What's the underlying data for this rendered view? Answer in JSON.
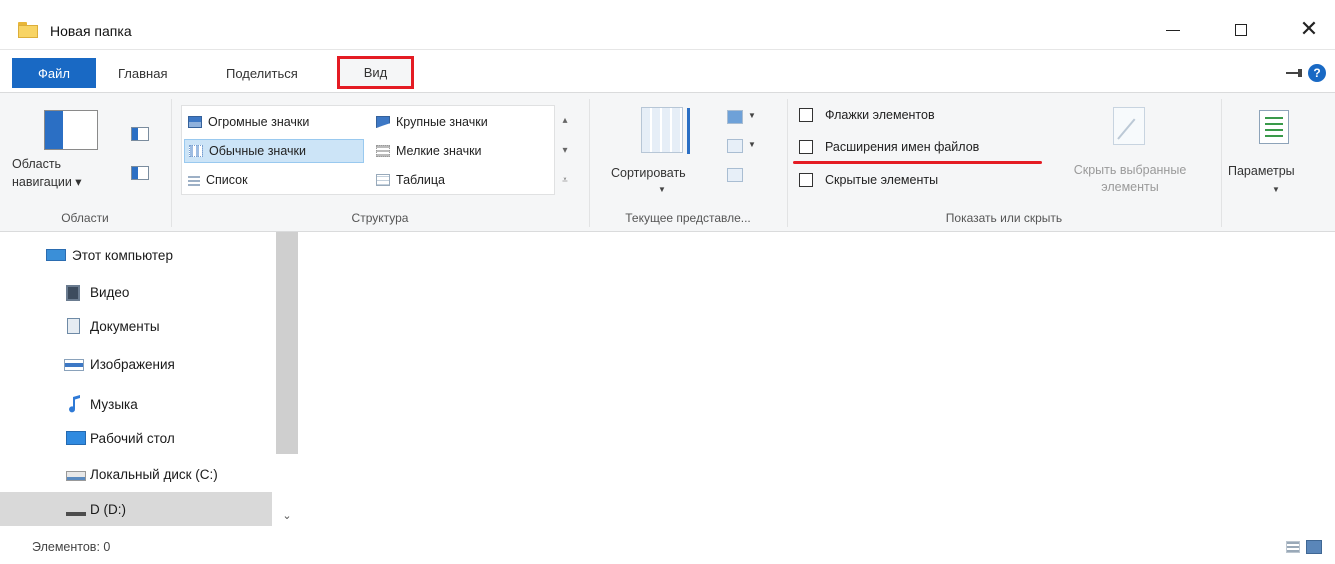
{
  "window": {
    "title": "Новая папка"
  },
  "ribbon_tabs": {
    "file": "Файл",
    "home": "Главная",
    "share": "Поделиться",
    "view": "Вид"
  },
  "groups": {
    "areas": {
      "label": "Области",
      "nav_pane_line1": "Область",
      "nav_pane_line2": "навигации ▾"
    },
    "structure": {
      "label": "Структура",
      "layouts": [
        "Огромные значки",
        "Крупные значки",
        "Обычные значки",
        "Мелкие значки",
        "Список",
        "Таблица"
      ],
      "selected_layout": "Обычные значки"
    },
    "current_view": {
      "label": "Текущее представле...",
      "sort_label": "Сортировать"
    },
    "show_hide": {
      "label": "Показать или скрыть",
      "item_checkboxes": "Флажки элементов",
      "file_extensions": "Расширения имен файлов",
      "hidden_items": "Скрытые элементы",
      "hide_selected_line1": "Скрыть выбранные",
      "hide_selected_line2": "элементы",
      "checked": {
        "item_checkboxes": false,
        "file_extensions": false,
        "hidden_items": false
      }
    },
    "options": {
      "label": "Параметры"
    }
  },
  "navigation": {
    "items": [
      {
        "label": "Этот компьютер",
        "icon": "computer-icon"
      },
      {
        "label": "Видео",
        "icon": "video-icon"
      },
      {
        "label": "Документы",
        "icon": "documents-icon"
      },
      {
        "label": "Изображения",
        "icon": "images-icon"
      },
      {
        "label": "Музыка",
        "icon": "music-icon"
      },
      {
        "label": "Рабочий стол",
        "icon": "desktop-icon"
      },
      {
        "label": "Локальный диск (C:)",
        "icon": "local-disk-icon"
      },
      {
        "label": "D (D:)",
        "icon": "drive-icon"
      }
    ],
    "selected": "D (D:)"
  },
  "status": {
    "items_count": "Элементов: 0"
  },
  "colors": {
    "accent": "#1969c4",
    "highlight_red": "#e41b23",
    "ribbon_bg": "#f5f6f7",
    "selection": "#cce4f7"
  }
}
